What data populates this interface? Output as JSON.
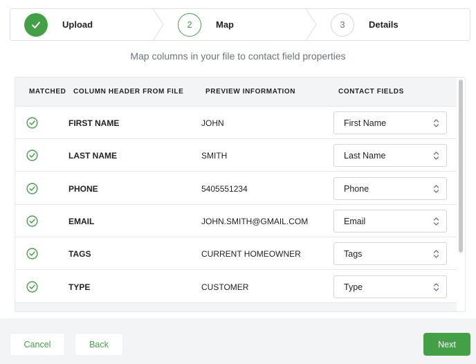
{
  "stepper": {
    "steps": [
      {
        "number": "",
        "label": "Upload",
        "state": "done",
        "icon": "check-icon"
      },
      {
        "number": "2",
        "label": "Map",
        "state": "active"
      },
      {
        "number": "3",
        "label": "Details",
        "state": "todo"
      }
    ]
  },
  "subtitle": "Map columns in your file to contact field properties",
  "table": {
    "columns": [
      "MATCHED",
      "COLUMN HEADER FROM FILE",
      "PREVIEW INFORMATION",
      "CONTACT FIELDS"
    ],
    "rows": [
      {
        "matched": true,
        "header": "FIRST NAME",
        "preview": "JOHN",
        "field": "First Name"
      },
      {
        "matched": true,
        "header": "LAST NAME",
        "preview": "SMITH",
        "field": "Last Name"
      },
      {
        "matched": true,
        "header": "PHONE",
        "preview": "5405551234",
        "field": "Phone"
      },
      {
        "matched": true,
        "header": "EMAIL",
        "preview": "JOHN.SMITH@GMAIL.COM",
        "field": "Email"
      },
      {
        "matched": true,
        "header": "TAGS",
        "preview": "CURRENT HOMEOWNER",
        "field": "Tags"
      },
      {
        "matched": true,
        "header": "TYPE",
        "preview": "CUSTOMER",
        "field": "Type"
      }
    ]
  },
  "footer": {
    "cancel_label": "Cancel",
    "back_label": "Back",
    "next_label": "Next"
  },
  "colors": {
    "accent": "#43a047",
    "muted": "#6b7280",
    "header_bg": "#f3f4f6"
  }
}
